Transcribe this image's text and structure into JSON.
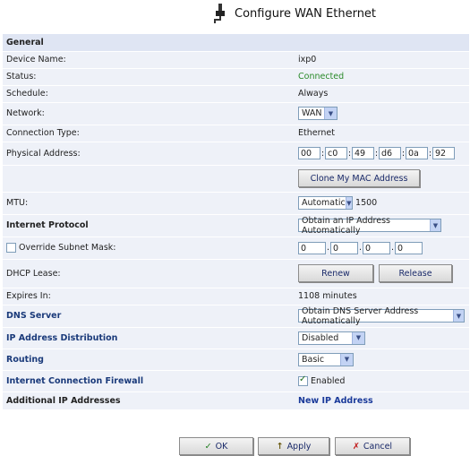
{
  "title": "Configure WAN Ethernet",
  "general_header": "General",
  "rows": {
    "device_name": {
      "label": "Device Name:",
      "value": "ixp0"
    },
    "status": {
      "label": "Status:",
      "value": "Connected"
    },
    "schedule": {
      "label": "Schedule:",
      "value": "Always"
    },
    "network": {
      "label": "Network:",
      "value": "WAN"
    },
    "connection_type": {
      "label": "Connection Type:",
      "value": "Ethernet"
    },
    "physical_address": {
      "label": "Physical Address:",
      "octets": [
        "00",
        "c0",
        "49",
        "d6",
        "0a",
        "92"
      ]
    },
    "clone_mac": {
      "label": "Clone My MAC Address"
    },
    "mtu": {
      "label": "MTU:",
      "mode": "Automatic",
      "value": "1500"
    },
    "internet_protocol": {
      "label": "Internet Protocol",
      "value": "Obtain an IP Address Automatically"
    },
    "override_subnet": {
      "label": "Override Subnet Mask:",
      "octets": [
        "0",
        "0",
        "0",
        "0"
      ]
    },
    "dhcp_lease": {
      "label": "DHCP Lease:",
      "renew": "Renew",
      "release": "Release"
    },
    "expires_in": {
      "label": "Expires In:",
      "value": "1108 minutes"
    },
    "dns_server": {
      "label": "DNS Server",
      "value": "Obtain DNS Server Address Automatically"
    },
    "ip_distribution": {
      "label": "IP Address Distribution",
      "value": "Disabled"
    },
    "routing": {
      "label": "Routing",
      "value": "Basic"
    },
    "firewall": {
      "label": "Internet Connection Firewall",
      "value": "Enabled"
    },
    "additional_ip": {
      "label": "Additional IP Addresses",
      "value": "New IP Address"
    }
  },
  "footer": {
    "ok": "OK",
    "apply": "Apply",
    "cancel": "Cancel"
  },
  "colors": {
    "row_bg": "#eef1f8",
    "header_bg": "#dfe5f3",
    "connected": "#2a8a2a",
    "section_label": "#1a3a7a"
  }
}
